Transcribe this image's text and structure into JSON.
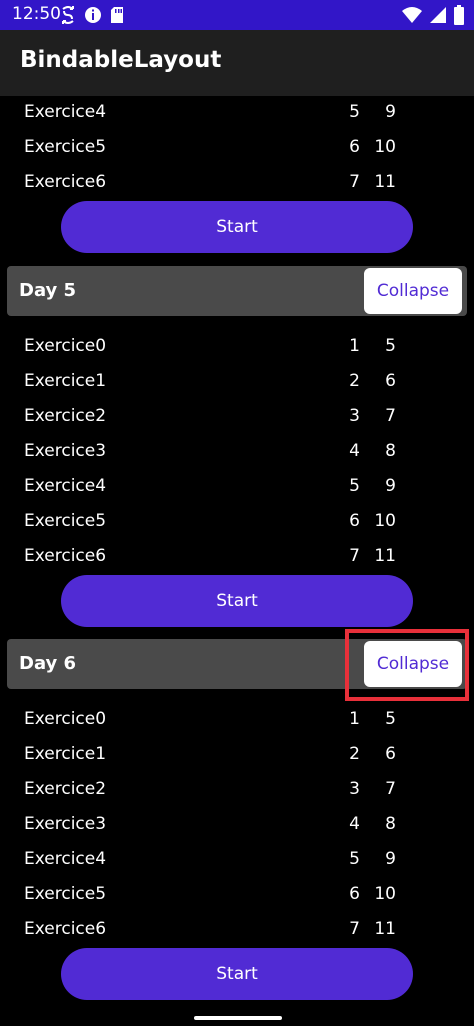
{
  "status_bar": {
    "time": "12:50",
    "background": "#3216c8",
    "left_icons": [
      "sync-icon",
      "info-icon",
      "sd-card-icon"
    ],
    "right_icons": [
      "wifi-icon",
      "signal-icon",
      "battery-icon"
    ]
  },
  "app_bar": {
    "title": "BindableLayout"
  },
  "colors": {
    "accent": "#512bd4",
    "highlight": "#e8303a",
    "header_bg": "#4a4a4a"
  },
  "sections": [
    {
      "partial": true,
      "exercises": [
        {
          "name": "Exercice4",
          "v1": "5",
          "v2": "9"
        },
        {
          "name": "Exercice5",
          "v1": "6",
          "v2": "10"
        },
        {
          "name": "Exercice6",
          "v1": "7",
          "v2": "11"
        }
      ],
      "start_label": "Start"
    },
    {
      "day": "Day 5",
      "collapse_label": "Collapse",
      "exercises": [
        {
          "name": "Exercice0",
          "v1": "1",
          "v2": "5"
        },
        {
          "name": "Exercice1",
          "v1": "2",
          "v2": "6"
        },
        {
          "name": "Exercice2",
          "v1": "3",
          "v2": "7"
        },
        {
          "name": "Exercice3",
          "v1": "4",
          "v2": "8"
        },
        {
          "name": "Exercice4",
          "v1": "5",
          "v2": "9"
        },
        {
          "name": "Exercice5",
          "v1": "6",
          "v2": "10"
        },
        {
          "name": "Exercice6",
          "v1": "7",
          "v2": "11"
        }
      ],
      "start_label": "Start"
    },
    {
      "day": "Day 6",
      "collapse_label": "Collapse",
      "highlighted": true,
      "exercises": [
        {
          "name": "Exercice0",
          "v1": "1",
          "v2": "5"
        },
        {
          "name": "Exercice1",
          "v1": "2",
          "v2": "6"
        },
        {
          "name": "Exercice2",
          "v1": "3",
          "v2": "7"
        },
        {
          "name": "Exercice3",
          "v1": "4",
          "v2": "8"
        },
        {
          "name": "Exercice4",
          "v1": "5",
          "v2": "9"
        },
        {
          "name": "Exercice5",
          "v1": "6",
          "v2": "10"
        },
        {
          "name": "Exercice6",
          "v1": "7",
          "v2": "11"
        }
      ],
      "start_label": "Start"
    }
  ]
}
